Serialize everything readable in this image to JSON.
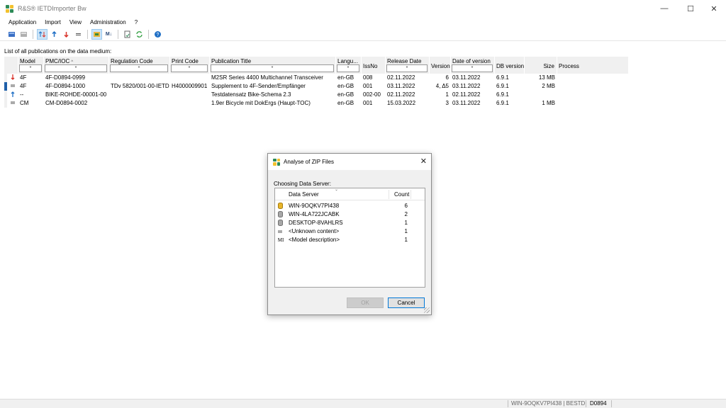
{
  "window": {
    "title": "R&S® IETDImporter Bw"
  },
  "menu": [
    "Application",
    "Import",
    "View",
    "Administration",
    "?"
  ],
  "toolbar": [
    "database-icon",
    "database-gray-icon",
    "sort-updown-icon",
    "arrow-up-blue-icon",
    "arrow-down-red-icon",
    "equals-icon",
    "model-view-icon",
    "ml-icon",
    "report-icon",
    "refresh-icon",
    "help-icon"
  ],
  "main": {
    "list_label": "List of all publications on the data medium:",
    "filter_placeholder": "*",
    "columns": [
      "Model",
      "PMC/IOC",
      "Regulation Code",
      "Print Code",
      "Publication Title",
      "Langu...",
      "IssNo",
      "Release Date",
      "Version",
      "Date of version",
      "DB version",
      "Size",
      "Process"
    ],
    "rows": [
      {
        "status": "down",
        "status_color": "#d9342b",
        "model": "4F",
        "pmc": "4F-D0894-0999",
        "reg_code": "",
        "print_code": "",
        "title": "M2SR Series 4400 Multichannel Transceiver",
        "lang": "en-GB",
        "issno": "008",
        "release": "02.11.2022",
        "version": "6",
        "date_version": "03.11.2022",
        "db": "6.9.1",
        "size": "13 MB",
        "process": ""
      },
      {
        "status": "equal",
        "status_color": "#555555",
        "model": "4F",
        "pmc": "4F-D0894-1000",
        "reg_code": "TDv 5820/001-00-IETD",
        "print_code": "H4000009901",
        "title": "Supplement to 4F-Sender/Empfänger",
        "lang": "en-GB",
        "issno": "001",
        "release": "03.11.2022",
        "version": "4, Δ5",
        "date_version": "03.11.2022",
        "db": "6.9.1",
        "size": "2 MB",
        "process": ""
      },
      {
        "status": "up",
        "status_color": "#1f6fc5",
        "model": "--",
        "pmc": "BIKE-ROHDE-00001-00",
        "reg_code": "",
        "print_code": "",
        "title": "Testdatensatz Bike-Schema 2.3",
        "lang": "en-GB",
        "issno": "002-00",
        "release": "02.11.2022",
        "version": "1",
        "date_version": "02.11.2022",
        "db": "6.9.1",
        "size": "",
        "process": ""
      },
      {
        "status": "equal",
        "status_color": "#555555",
        "model": "CM",
        "pmc": "CM-D0894-0002",
        "reg_code": "",
        "print_code": "",
        "title": "1.9er Bicycle mit DokErgs (Haupt-TOC)",
        "lang": "en-GB",
        "issno": "001",
        "release": "15.03.2022",
        "version": "3",
        "date_version": "03.11.2022",
        "db": "6.9.1",
        "size": "1 MB",
        "process": ""
      }
    ]
  },
  "dialog": {
    "title": "Analyse of ZIP Files",
    "label": "Choosing Data Server:",
    "col_server": "Data Server",
    "col_count": "Count",
    "items": [
      {
        "icon": "db-yellow-icon",
        "name": "WIN-9OQKV7PI438",
        "count": "6"
      },
      {
        "icon": "db-gray-icon",
        "name": "WIN-4LA722JCABK",
        "count": "2"
      },
      {
        "icon": "db-gray-icon",
        "name": "DESKTOP-8VAHLRS",
        "count": "1"
      },
      {
        "icon": "unknown-icon",
        "name": "<Unknown content>",
        "count": "1"
      },
      {
        "icon": "model-icon",
        "name": "<Model description>",
        "count": "1"
      }
    ],
    "ok_label": "OK",
    "cancel_label": "Cancel"
  },
  "status": {
    "server": "WIN-9OQKV7PI438 | BESTD",
    "code": "D0894"
  }
}
